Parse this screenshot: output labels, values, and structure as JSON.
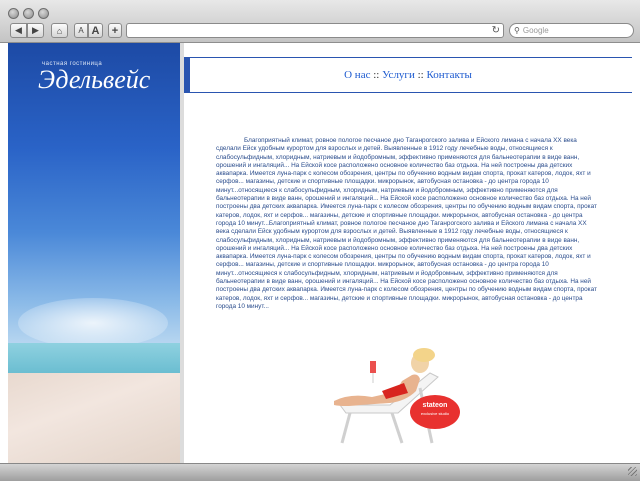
{
  "browser": {
    "back_label": "◀",
    "forward_label": "▶",
    "font_small_label": "A",
    "font_large_label": "A",
    "add_label": "+",
    "home_label": "⌂",
    "reload_label": "↻",
    "search_placeholder": "Google"
  },
  "site": {
    "tagline": "частная гостиница",
    "name": "Эдельвейс"
  },
  "nav": {
    "items": [
      "О нас",
      "Услуги",
      "Контакты"
    ],
    "separator": "::"
  },
  "body_text": "Благоприятный климат, ровное пологое песчаное дно Таганрогского залива и Ейского лимана с начала ХХ века сделали Ейск удобным курортом для взрослых и детей. Выявленные в 1912 году лечебные воды, относящиеся к слабосульфидным, хлоридным, натриевым и йодобромным, эффективно применяются для бальнеотерапии в виде ванн, орошений и ингаляций... На Ейской косе расположено основное количество баз отдыха. На ней построены два детских аквапарка. Имеется луна-парк с колесом обозрения, центры по обучению водным видам спорта, прокат катеров, лодок, яхт и серфов... магазины, детские и спортивные площадки. микрорынок, автобусная остановка - до центра города 10 минут...относящиеся к слабосульфидным, хлоридным, натриевым и йодобромным, эффективно применяются для бальнеотерапии в виде ванн, орошений и ингаляций... На Ейской косе расположено основное количество баз отдыха. На ней построены два детских аквапарка. Имеется луна-парк с колесом обозрения, центры по обучению водным видам спорта, прокат катеров, лодок, яхт и серфов... магазины, детские и спортивные площадки. микрорынок, автобусная остановка - до центра города 10 минут...Благоприятный климат, ровное пологое песчаное дно Таганрогского залива и Ейского лимана с начала ХХ века сделали Ейск удобным курортом для взрослых и детей. Выявленные в 1912 году лечебные воды, относящиеся к слабосульфидным, хлоридным, натриевым и йодобромным, эффективно применяются для бальнеотерапии в виде ванн, орошений и ингаляций... На Ейской косе расположено основное количество баз отдыха. На ней построены два детских аквапарка. Имеется луна-парк с колесом обозрения, центры по обучению водным видам спорта, прокат катеров, лодок, яхт и серфов... магазины, детские и спортивные площадки. микрорынок, автобусная остановка - до центра города 10 минут...относящиеся к слабосульфидным, хлоридным, натриевым и йодобромным, эффективно применяются для бальнеотерапии в виде ванн, орошений и ингаляций... На Ейской косе расположено основное количество баз отдыха. На ней построены два детских аквапарка. Имеется луна-парк с колесом обозрения, центры по обучению водным видам спорта, прокат катеров, лодок, яхт и серфов... магазины, детские и спортивные площадки. микрорынок, автобусная остановка - до центра города 10 минут...",
  "badge": {
    "line1": "stateon",
    "line2": "exclusive studio"
  },
  "colors": {
    "accent_blue": "#1e5bd0",
    "nav_border": "#2a55b0",
    "badge_red": "#e8312f"
  }
}
